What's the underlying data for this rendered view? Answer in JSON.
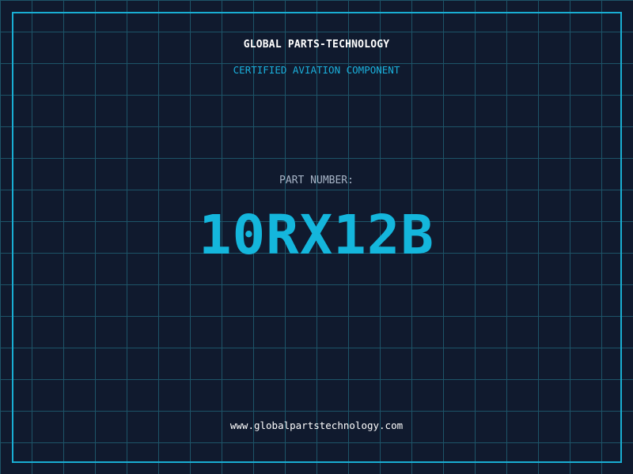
{
  "header": {
    "company": "GLOBAL PARTS-TECHNOLOGY",
    "subtitle": "CERTIFIED AVIATION COMPONENT"
  },
  "part": {
    "label": "PART NUMBER:",
    "number": "10RX12B"
  },
  "footer": {
    "website": "www.globalpartstechnology.com"
  },
  "colors": {
    "background": "#101a2e",
    "grid": "#1d5468",
    "accent": "#19aed3",
    "text_primary": "#ffffff",
    "text_muted": "#a7b4c6"
  }
}
